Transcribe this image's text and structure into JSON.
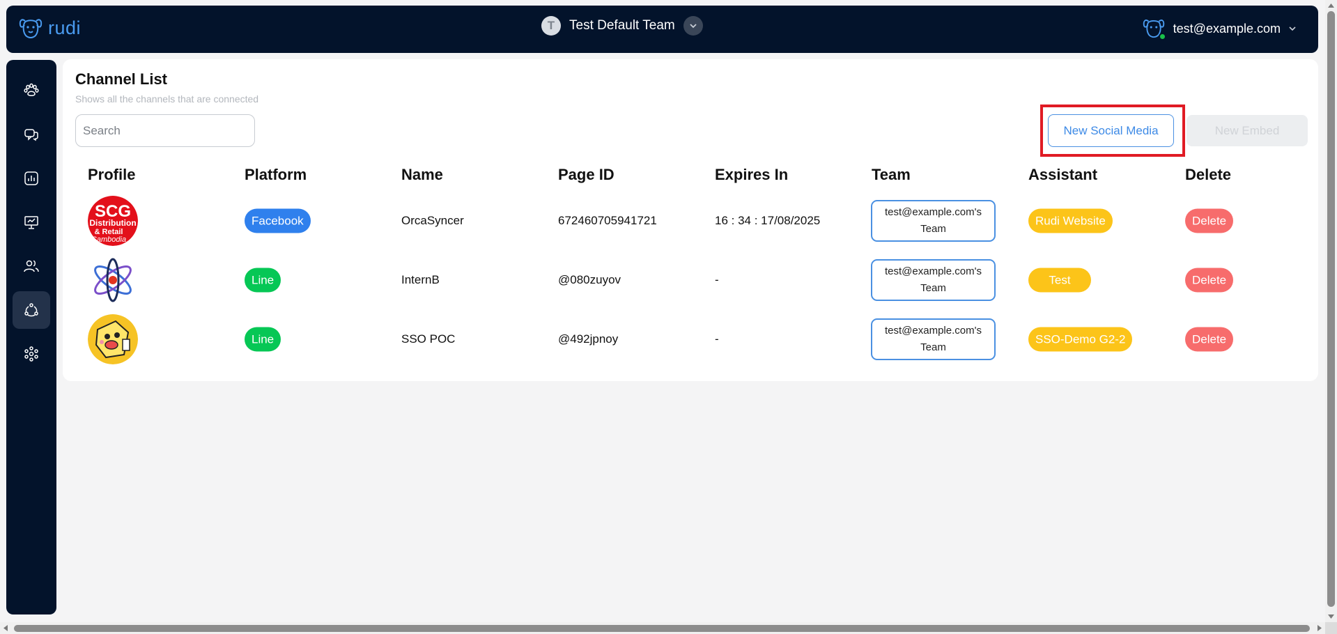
{
  "header": {
    "brand": "rudi",
    "team_initial": "T",
    "team_name": "Test Default Team",
    "user_email": "test@example.com"
  },
  "sidebar": {
    "items": [
      {
        "icon": "paw-icon"
      },
      {
        "icon": "chat-icon"
      },
      {
        "icon": "analytics-icon"
      },
      {
        "icon": "presentation-icon"
      },
      {
        "icon": "users-icon"
      },
      {
        "icon": "channels-icon",
        "active": true
      },
      {
        "icon": "network-icon"
      }
    ]
  },
  "main": {
    "title": "Channel List",
    "subtitle": "Shows all the channels that are connected",
    "search_placeholder": "Search",
    "new_social_label": "New Social Media",
    "new_embed_label": "New Embed",
    "columns": [
      "Profile",
      "Platform",
      "Name",
      "Page ID",
      "Expires In",
      "Team",
      "Assistant",
      "Delete"
    ],
    "rows": [
      {
        "avatar": "scg-avatar",
        "avatar_text": [
          "SCG",
          "Distribution",
          "& Retail",
          "Cambodia"
        ],
        "platform": "Facebook",
        "name": "OrcaSyncer",
        "page_id": "672460705941721",
        "expires": "16 : 34 : 17/08/2025",
        "team": "test@example.com's Team",
        "assistant": "Rudi Website",
        "delete": "Delete"
      },
      {
        "avatar": "atom-avatar",
        "platform": "Line",
        "name": "InternB",
        "page_id": "@080zuyov",
        "expires": "-",
        "team": "test@example.com's Team",
        "assistant": "Test",
        "delete": "Delete"
      },
      {
        "avatar": "cartoon-avatar",
        "platform": "Line",
        "name": "SSO POC",
        "page_id": "@492jpnoy",
        "expires": "-",
        "team": "test@example.com's Team",
        "assistant": "SSO-Demo G2-2",
        "delete": "Delete"
      }
    ]
  },
  "colors": {
    "nav_bg": "#03132b",
    "accent_blue": "#2f80ed",
    "line_green": "#06c755",
    "assistant_yellow": "#fcc419",
    "delete_red": "#f76c6c",
    "highlight_red": "#e01b24"
  }
}
